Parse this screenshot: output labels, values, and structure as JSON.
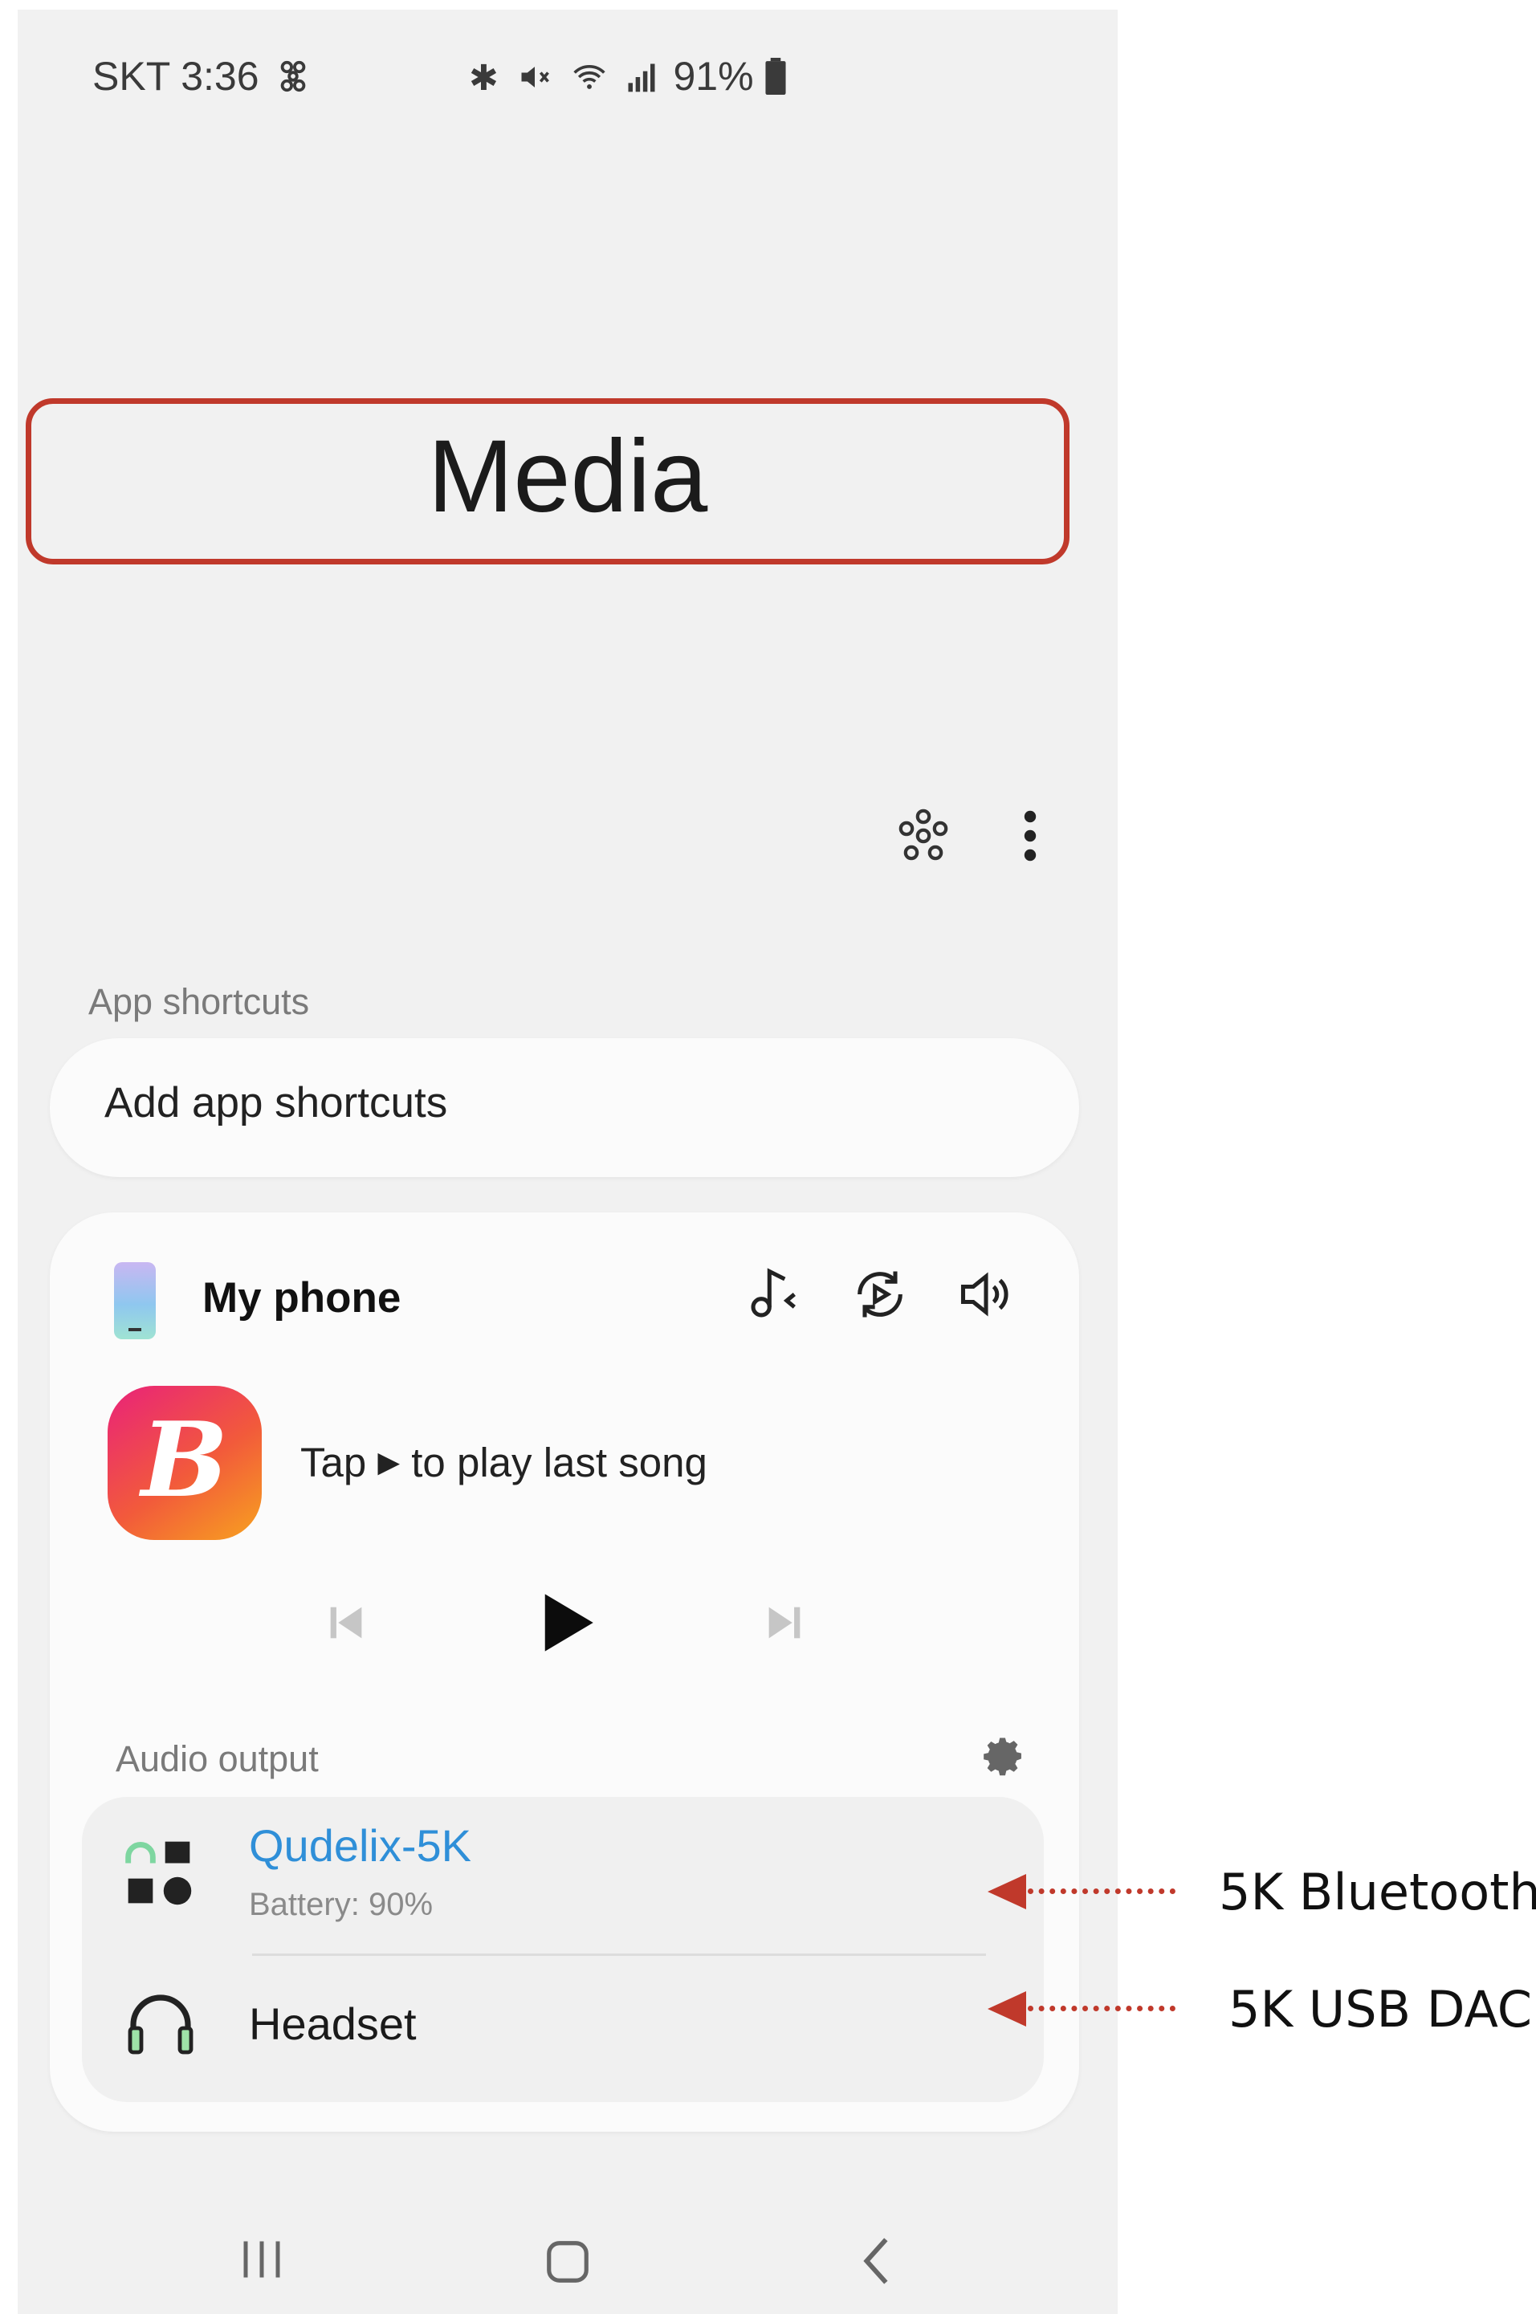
{
  "status_bar": {
    "carrier_time": "SKT 3:36",
    "battery": "91%"
  },
  "callout": {
    "title": "Media"
  },
  "app_shortcuts": {
    "label": "App shortcuts",
    "add_label": "Add app shortcuts"
  },
  "player": {
    "device": "My phone",
    "prompt_prefix": "Tap",
    "play_glyph": "▶",
    "prompt_suffix": "to play last song",
    "app_icon_letter": "B"
  },
  "audio_output": {
    "label": "Audio output",
    "devices": [
      {
        "name": "Qudelix-5K",
        "sub": "Battery: 90%"
      },
      {
        "name": "Headset"
      }
    ]
  },
  "annotations": {
    "bluetooth": "5K Bluetooth",
    "usb_dac": "5K USB DAC"
  },
  "colors": {
    "callout": "#c0392b",
    "active_device": "#2f8fd8",
    "phone_bg": "#f1f1f1"
  }
}
